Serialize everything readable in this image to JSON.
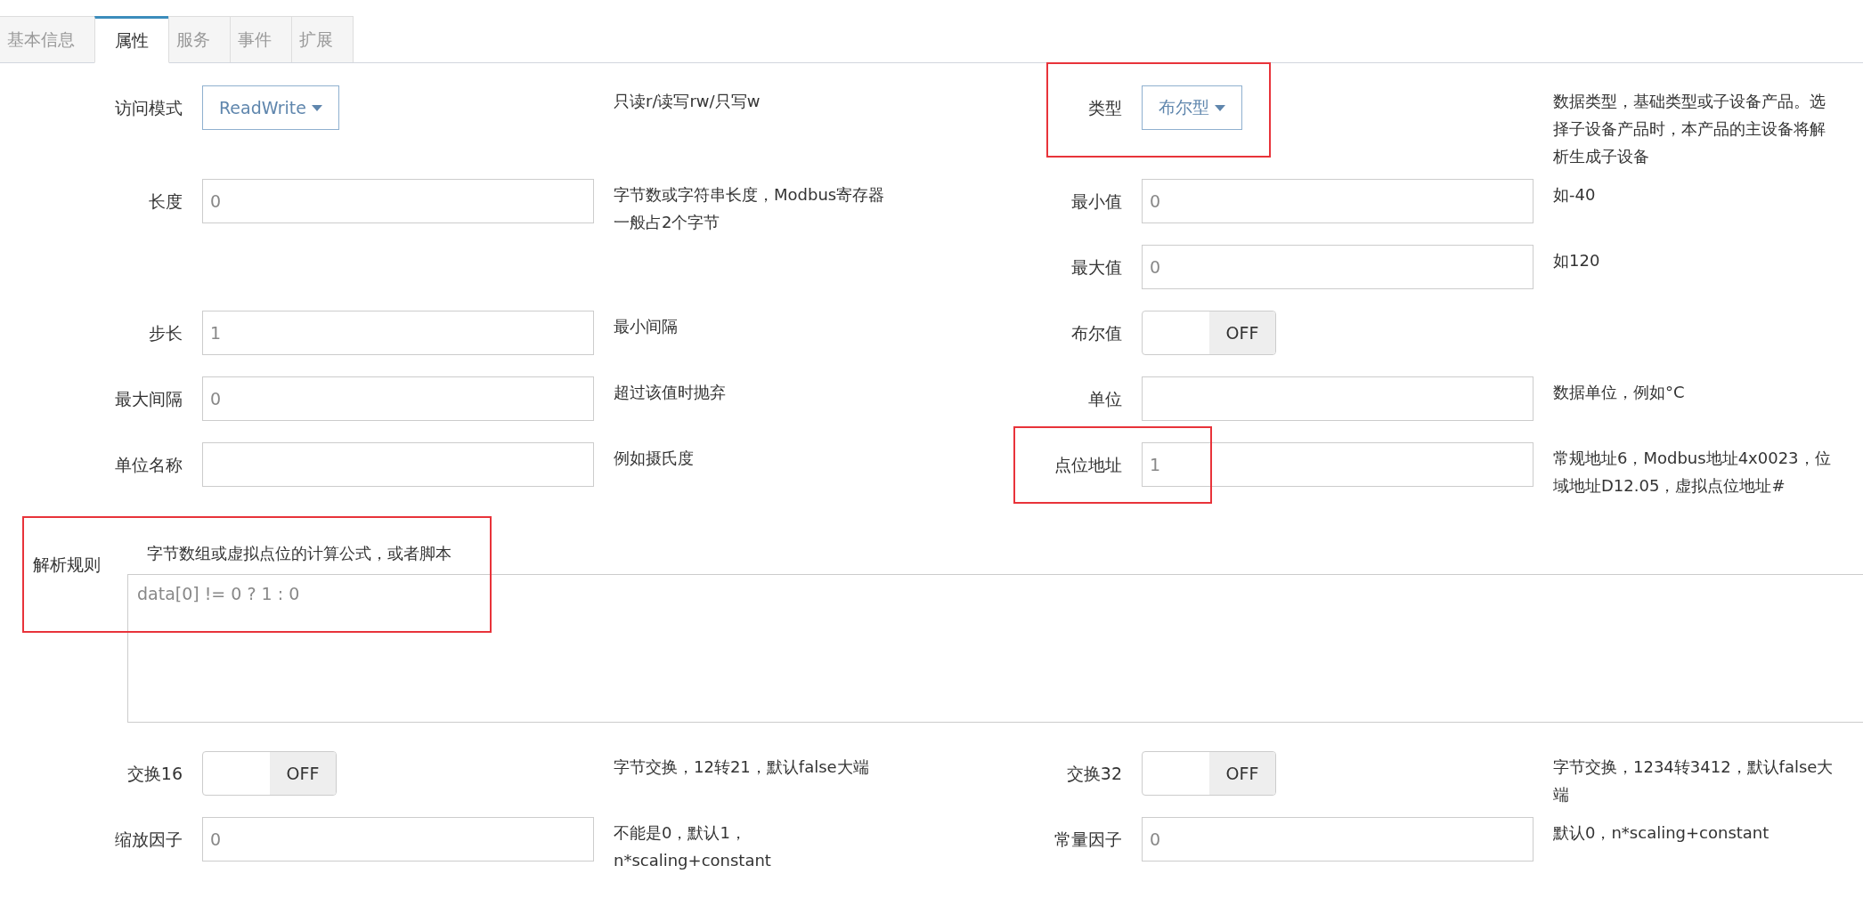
{
  "tabs": [
    {
      "label": "基本信息",
      "selected": false
    },
    {
      "label": "属性",
      "selected": true
    },
    {
      "label": "服务",
      "selected": false
    },
    {
      "label": "事件",
      "selected": false
    },
    {
      "label": "扩展",
      "selected": false
    }
  ],
  "rows": [
    {
      "left": {
        "label": "访问模式",
        "kind": "select",
        "value": "ReadWrite",
        "help": "只读r/读写rw/只写w"
      },
      "right": {
        "label": "类型",
        "kind": "select",
        "value": "布尔型",
        "help": "数据类型，基础类型或子设备产品。选择子设备产品时，本产品的主设备将解析生成子设备",
        "highlighted": true
      }
    },
    {
      "left": {
        "label": "长度",
        "kind": "input",
        "value": "0",
        "help": "字节数或字符串长度，Modbus寄存器一般占2个字节"
      },
      "right": {
        "label": "最小值",
        "kind": "input",
        "value": "0",
        "help": "如-40"
      }
    },
    {
      "left": null,
      "right": {
        "label": "最大值",
        "kind": "input",
        "value": "0",
        "help": "如120"
      }
    },
    {
      "left": {
        "label": "步长",
        "kind": "input",
        "value": "1",
        "help": "最小间隔"
      },
      "right": {
        "label": "布尔值",
        "kind": "toggle",
        "on": false,
        "value": "OFF"
      }
    },
    {
      "left": {
        "label": "最大间隔",
        "kind": "input",
        "value": "0",
        "help": "超过该值时抛弃"
      },
      "right": {
        "label": "单位",
        "kind": "input",
        "help": "数据单位，例如°C"
      }
    },
    {
      "left": {
        "label": "单位名称",
        "kind": "input",
        "help": "例如摄氏度"
      },
      "right": {
        "label": "点位地址",
        "kind": "input",
        "value": "1",
        "help": "常规地址6，Modbus地址4x0023，位域地址D12.05，虚拟点位地址#",
        "highlighted": true
      }
    }
  ],
  "parse_rule": {
    "label": "解析规则",
    "help": "字节数组或虚拟点位的计算公式，或者脚本",
    "value": "data[0] != 0 ? 1 : 0",
    "highlighted": true
  },
  "bottom_rows": [
    {
      "left": {
        "label": "交换16",
        "kind": "toggle",
        "on": false,
        "value": "OFF",
        "help": "字节交换，12转21，默认false大端"
      },
      "right": {
        "label": "交换32",
        "kind": "toggle",
        "on": false,
        "value": "OFF",
        "help": "字节交换，1234转3412，默认false大端"
      }
    },
    {
      "left": {
        "label": "缩放因子",
        "kind": "input",
        "value": "0",
        "help": "不能是0，默认1，n*scaling+constant"
      },
      "right": {
        "label": "常量因子",
        "kind": "input",
        "value": "0",
        "help": "默认0，n*scaling+constant"
      }
    }
  ]
}
